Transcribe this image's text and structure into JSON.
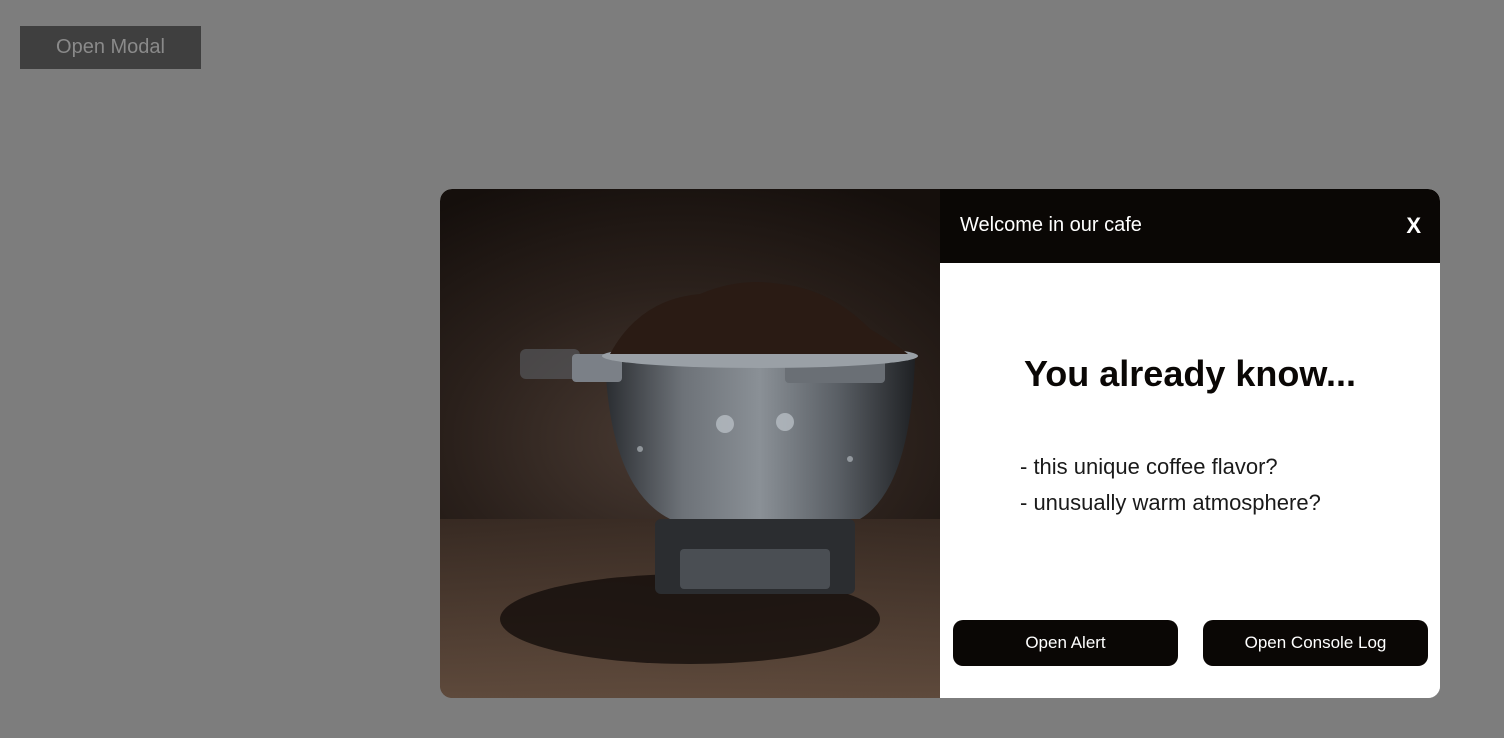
{
  "page": {
    "open_modal_label": "Open Modal"
  },
  "modal": {
    "title": "Welcome in our cafe",
    "close_label": "X",
    "heading": "You already know...",
    "features": [
      "- this unique coffee flavor?",
      "- unusually warm atmosphere?"
    ],
    "buttons": {
      "alert_label": "Open Alert",
      "console_label": "Open Console Log"
    },
    "image": {
      "icon": "coffee-portafilter-photo"
    }
  },
  "colors": {
    "backdrop": "#7d7d7d",
    "open_modal_bg": "#3f3f3f",
    "header_bg": "#0a0705",
    "button_bg": "#0a0705",
    "modal_bg": "#ffffff"
  }
}
